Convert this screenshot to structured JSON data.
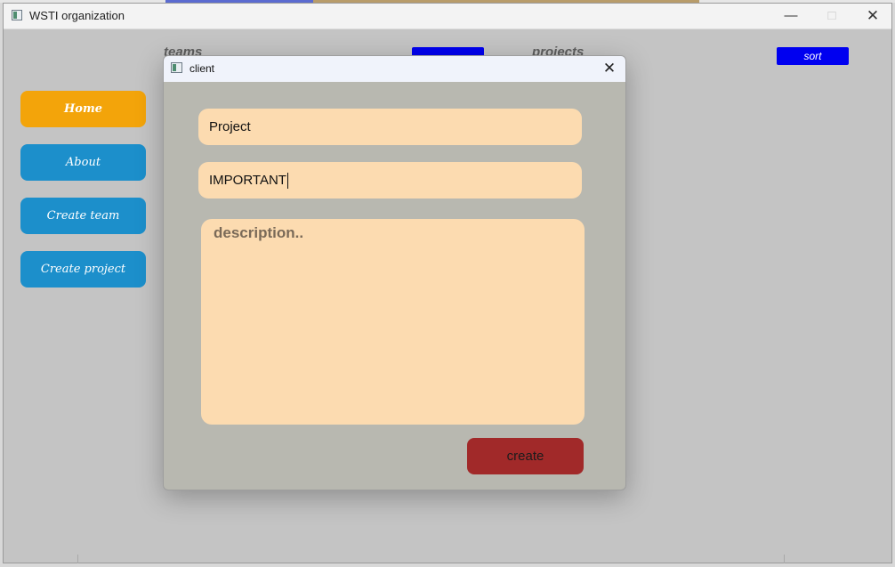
{
  "window": {
    "title": "WSTI organization"
  },
  "nav": {
    "home": "Home",
    "about": "About",
    "create_team": "Create team",
    "create_project": "Create project"
  },
  "headers": {
    "teams": "teams",
    "projects": "projects"
  },
  "buttons": {
    "top_blue": "",
    "sort": "sort"
  },
  "dialog": {
    "title": "client",
    "project_name": "Project",
    "priority": "IMPORTANT",
    "description_placeholder": "description..",
    "create_label": "create"
  },
  "colors": {
    "home_accent": "#f3a40a",
    "nav_blue": "#1c8fcb",
    "field_bg": "#fcdbb0",
    "create_button": "#a12929",
    "sort_button": "#0000f0"
  },
  "icons": [
    "app-icon",
    "minimize-icon",
    "maximize-icon",
    "close-icon"
  ]
}
